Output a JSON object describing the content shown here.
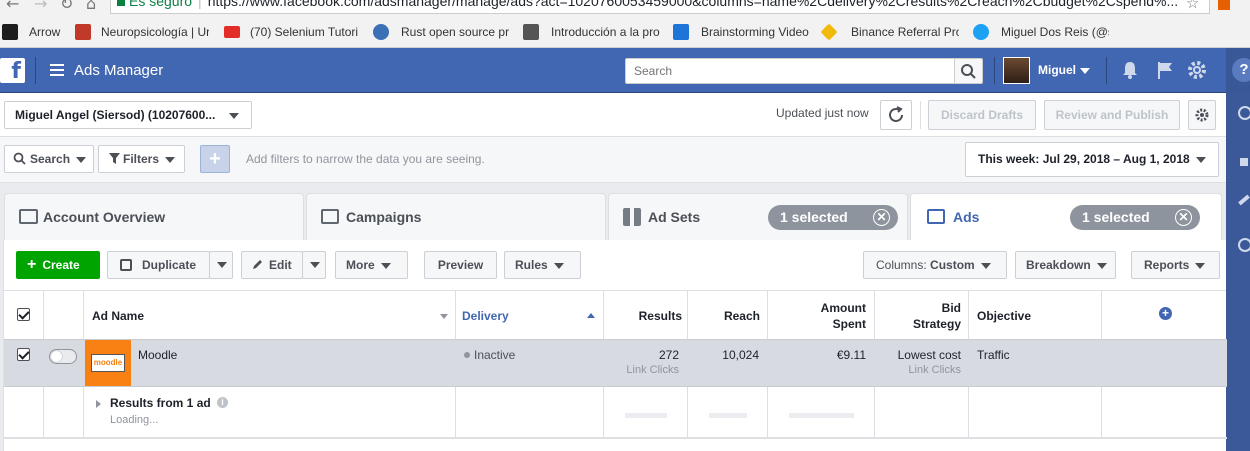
{
  "browser": {
    "secure_label": "Es seguro",
    "url": "https://www.facebook.com/adsmanager/manage/ads?act=1020760053459000&columns=name%2Cdelivery%2Cresults%2Creach%2Cbudget%2Cspend%..."
  },
  "bookmarks": [
    {
      "label": "Arrow",
      "color": "#1d1d1d"
    },
    {
      "label": "Neuropsicología | Ur",
      "color": "#c0392b"
    },
    {
      "label": "(70) Selenium Tutori",
      "color": "#e52d27"
    },
    {
      "label": "Rust open source pro",
      "color": "#3b6fb6"
    },
    {
      "label": "Introducción a la pro",
      "color": "#555555"
    },
    {
      "label": "Brainstorming Video",
      "color": "#1f74d8"
    },
    {
      "label": "Binance Referral Prog",
      "color": "#f0b90b"
    },
    {
      "label": "Miguel Dos Reis (@s",
      "color": "#1da1f2"
    }
  ],
  "topbar": {
    "app_name": "Ads Manager",
    "search_placeholder": "Search",
    "user_name": "Miguel",
    "brand_color": "#4267b2"
  },
  "account": {
    "selector_label": "Miguel Angel (Siersod) (10207600...",
    "updated_text": "Updated just now",
    "discard_label": "Discard Drafts",
    "review_label": "Review and Publish"
  },
  "filters": {
    "search_label": "Search",
    "filters_label": "Filters",
    "hint": "Add filters to narrow the data you are seeing.",
    "date_range": "This week: Jul 29, 2018 – Aug 1, 2018"
  },
  "tabs": {
    "overview": "Account Overview",
    "campaigns": "Campaigns",
    "adsets": "Ad Sets",
    "adsets_selected": "1 selected",
    "ads": "Ads",
    "ads_selected": "1 selected"
  },
  "actions": {
    "create": "Create",
    "duplicate": "Duplicate",
    "edit": "Edit",
    "more": "More",
    "preview": "Preview",
    "rules": "Rules",
    "columns_prefix": "Columns:",
    "columns_value": "Custom",
    "breakdown": "Breakdown",
    "reports": "Reports",
    "create_color": "#00a400"
  },
  "table": {
    "headers": {
      "ad_name": "Ad Name",
      "delivery": "Delivery",
      "results": "Results",
      "reach": "Reach",
      "amount_spent_1": "Amount",
      "amount_spent_2": "Spent",
      "bid_1": "Bid",
      "bid_2": "Strategy",
      "objective": "Objective"
    },
    "row": {
      "ad_name": "Moodle",
      "thumb_text": "moodle",
      "delivery": "Inactive",
      "results": "272",
      "results_sub": "Link Clicks",
      "reach": "10,024",
      "spent": "€9.11",
      "bid": "Lowest cost",
      "bid_sub": "Link Clicks",
      "objective": "Traffic"
    },
    "summary": {
      "label": "Results from 1 ad",
      "loading": "Loading..."
    }
  }
}
